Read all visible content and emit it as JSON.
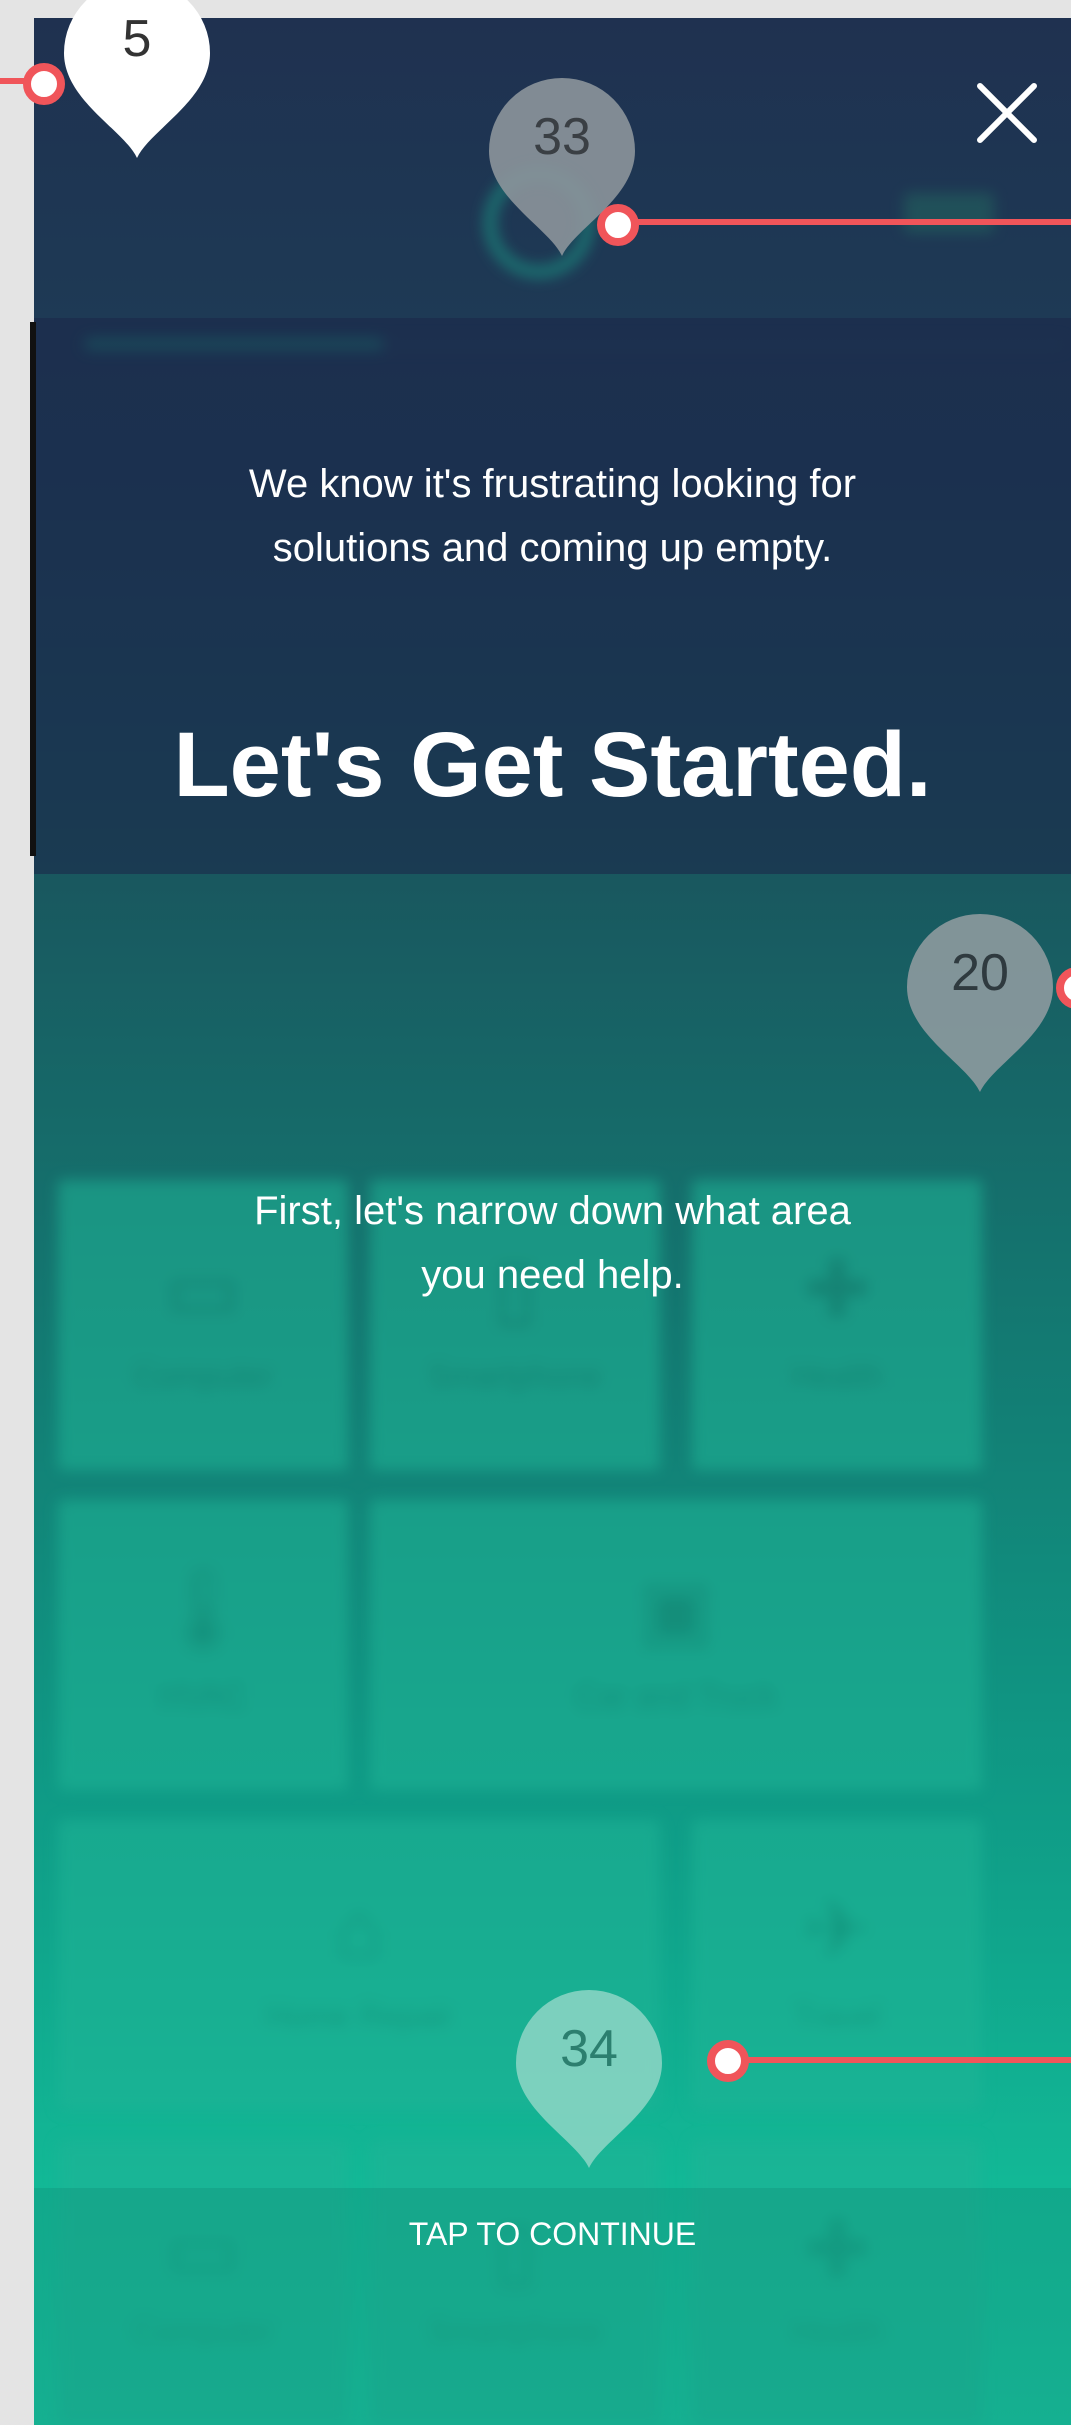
{
  "overlay": {
    "intro_text": "We know it's frustrating looking for solutions and coming up empty.",
    "headline": "Let's Get Started.",
    "hint_text": "First, let's narrow down what area you need help.",
    "tap_to_continue": "TAP TO CONTINUE"
  },
  "background_screen": {
    "categories": [
      {
        "label": "Computer",
        "icon": "laptop-icon"
      },
      {
        "label": "Smartphone",
        "icon": "smartphone-icon"
      },
      {
        "label": "Health",
        "icon": "bandage-icon"
      },
      {
        "label": "HVAC",
        "icon": "thermometer-icon"
      },
      {
        "label": "Car and Truck",
        "icon": "car-icon"
      },
      {
        "label": "Home Repair",
        "icon": "house-icon"
      },
      {
        "label": "Travel",
        "icon": "airplane-icon"
      },
      {
        "label": "Computer",
        "icon": "laptop-icon"
      },
      {
        "label": "Smartphone",
        "icon": "smartphone-icon"
      },
      {
        "label": "Health",
        "icon": "bandage-icon"
      }
    ]
  },
  "annotations": {
    "markers": [
      {
        "number": "5",
        "style": "white"
      },
      {
        "number": "33",
        "style": "gray"
      },
      {
        "number": "20",
        "style": "gray"
      },
      {
        "number": "34",
        "style": "teal"
      }
    ],
    "line_color": "#f0555a"
  },
  "colors": {
    "gradient_top": "#1f3150",
    "gradient_bottom": "#18c39e",
    "text": "#ffffff"
  }
}
